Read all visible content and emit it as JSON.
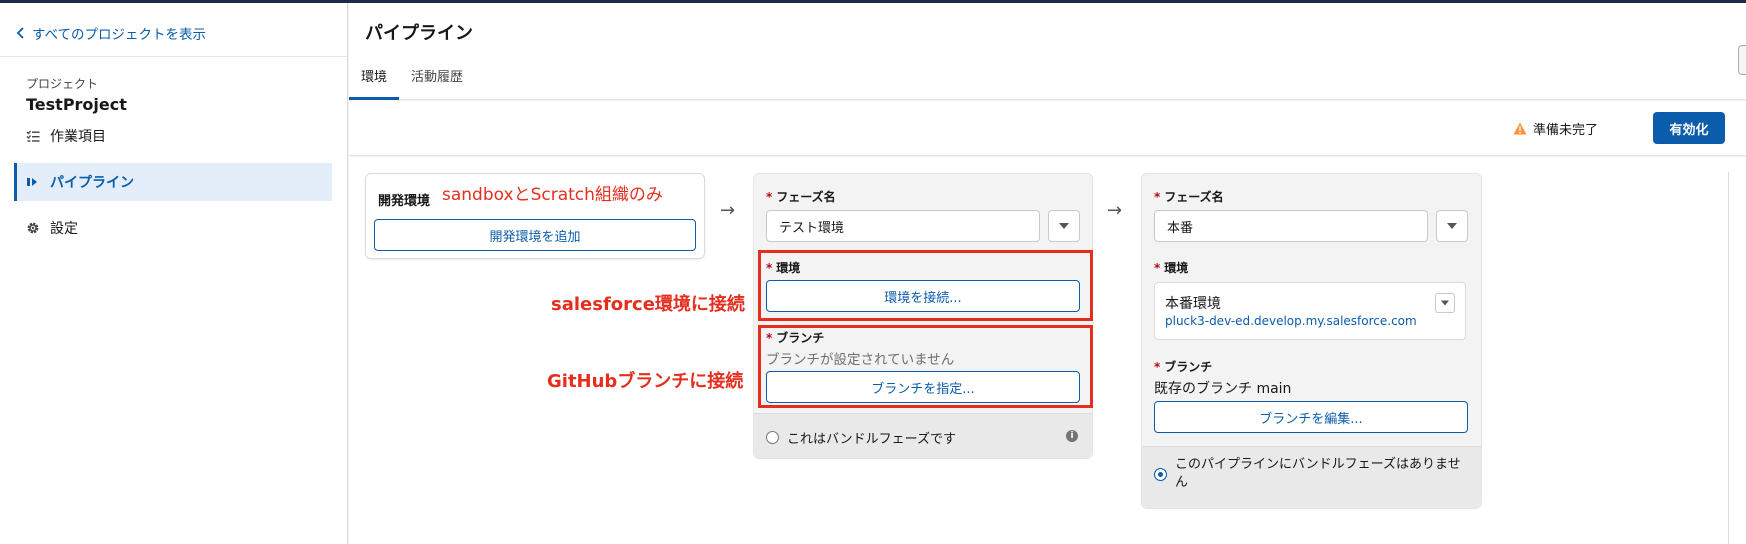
{
  "sidebar": {
    "back_link": "すべてのプロジェクトを表示",
    "project_caption": "プロジェクト",
    "project_name": "TestProject",
    "nav": [
      {
        "label": "作業項目",
        "icon": "list-icon"
      },
      {
        "label": "パイプライン",
        "icon": "pipeline-icon",
        "active": true
      },
      {
        "label": "設定",
        "icon": "gear-icon"
      }
    ]
  },
  "header": {
    "title": "パイプライン",
    "tabs": [
      {
        "label": "環境",
        "active": true
      },
      {
        "label": "活動履歴",
        "active": false
      }
    ]
  },
  "actions": {
    "status": "準備未完了",
    "status_icon": "warning-icon",
    "enable_button": "有効化"
  },
  "dev_stage": {
    "title": "開発環境",
    "add_button": "開発環境を追加"
  },
  "stage_test": {
    "phase_name_label": "フェーズ名",
    "phase_name_value": "テスト環境",
    "env_label": "環境",
    "connect_env_button": "環境を接続...",
    "branch_label": "ブランチ",
    "branch_empty": "ブランチが設定されていません",
    "specify_branch_button": "ブランチを指定...",
    "bundle_label": "これはバンドルフェーズです"
  },
  "stage_prod": {
    "phase_name_label": "フェーズ名",
    "phase_name_value": "本番",
    "env_label": "環境",
    "env_name": "本番環境",
    "env_url": "pluck3-dev-ed.develop.my.salesforce.com",
    "branch_label": "ブランチ",
    "branch_value": "既存のブランチ main",
    "edit_branch_button": "ブランチを編集...",
    "bundle_label": "このパイプラインにバンドルフェーズはありません"
  },
  "annotations": {
    "sandbox_note": "sandboxとScratch組織のみ",
    "salesforce_note": "salesforce環境に接続",
    "github_note": "GitHubブランチに接続"
  },
  "colors": {
    "brand": "#0b5cab",
    "annotation": "#e52e1e",
    "warning": "#fe9339",
    "required": "#ba0517"
  }
}
